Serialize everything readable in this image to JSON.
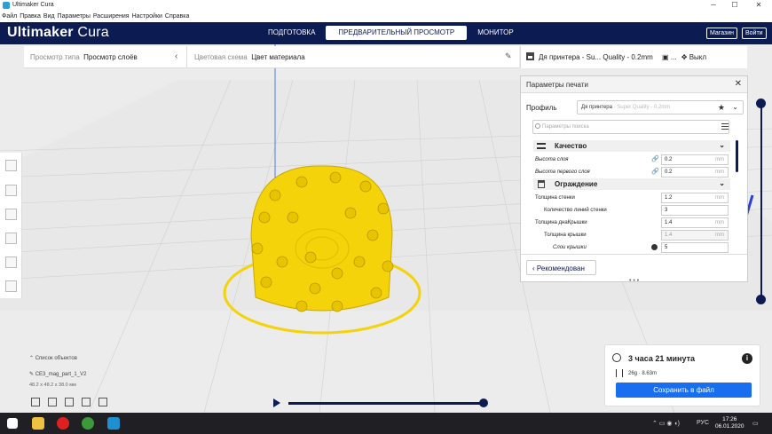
{
  "window": {
    "title": "Ultimaker Cura"
  },
  "menu": [
    "Файл",
    "Правка",
    "Вид",
    "Параметры",
    "Расширения",
    "Настройки",
    "Справка"
  ],
  "header": {
    "logo_bold": "Ultimaker",
    "logo_rest": "Cura",
    "stages": [
      "ПОДГОТОВКА",
      "ПРЕДВАРИТЕЛЬНЫЙ ПРОСМОТР",
      "МОНИТОР"
    ],
    "marketplace": "Магазин",
    "login": "Войти"
  },
  "viewbar": {
    "view_type_label": "Просмотр типа",
    "view_type_value": "Просмотр слоёв",
    "color_scheme_label": "Цветовая схема",
    "color_scheme_value": "Цвет материала"
  },
  "printerbar": {
    "text": "Дя принтера - Su... Quality - 0.2mm",
    "dots": "...",
    "support": "Выкл"
  },
  "panel": {
    "title": "Параметры печати",
    "profile_label": "Профиль",
    "profile_value": "Дя принтера",
    "profile_sub": "- Super Quality - 0.2mm",
    "search_placeholder": "Параметры поиска",
    "categories": [
      {
        "name": "Качество",
        "settings": [
          {
            "name": "Высота слоя",
            "value": "0.2",
            "unit": "mm",
            "italic": true,
            "linked": true
          },
          {
            "name": "Высота первого слоя",
            "value": "0.2",
            "unit": "mm",
            "italic": true,
            "linked": true
          }
        ]
      },
      {
        "name": "Ограждение",
        "settings": [
          {
            "name": "Толщина стенки",
            "value": "1.2",
            "unit": "mm",
            "indent": 0
          },
          {
            "name": "Количество линий стенки",
            "value": "3",
            "unit": "",
            "indent": 1
          },
          {
            "name": "Толщина днаКрышки",
            "value": "1.4",
            "unit": "mm",
            "indent": 0
          },
          {
            "name": "Толщина крышки",
            "value": "1.4",
            "unit": "mm",
            "indent": 1,
            "disabled": true
          },
          {
            "name": "Слои крышки",
            "value": "5",
            "unit": "",
            "indent": 2,
            "italic": true,
            "reset": true
          }
        ]
      }
    ],
    "recommended_button": "Рекомендован"
  },
  "objects": {
    "list_label": "Список объектов",
    "file": "CE3_mag_part_1_V2",
    "dims": "48.2 x 48.2 x 38.0 мм"
  },
  "output": {
    "time": "3 часа 21 минута",
    "material": "26g · 8.63m",
    "save_button": "Сохранить в файл"
  },
  "taskbar": {
    "lang": "РУС",
    "time": "17:26",
    "date": "06.01.2020"
  },
  "colors": {
    "brand": "#0c1b52",
    "accent": "#196ef0",
    "model": "#f5d30a"
  }
}
